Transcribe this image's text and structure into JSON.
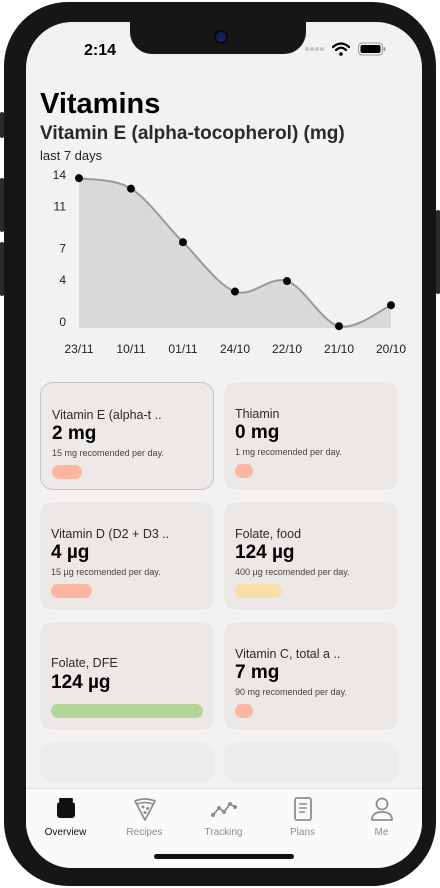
{
  "status": {
    "time": "2:14"
  },
  "header": {
    "title": "Vitamins",
    "subtitle": "Vitamin E (alpha-tocopherol) (mg)",
    "period": "last 7 days"
  },
  "chart_data": {
    "type": "area",
    "x": [
      "23/11",
      "10/11",
      "01/11",
      "24/10",
      "22/10",
      "21/10",
      "20/10"
    ],
    "values": [
      13.7,
      12.7,
      7.6,
      2.9,
      3.9,
      -0.4,
      1.6
    ],
    "yticks": [
      0,
      4,
      7,
      11,
      14
    ],
    "ylim": [
      0,
      14
    ],
    "grid": false,
    "colors": {
      "fill": "#d9d9d9",
      "line": "#9a9a9a",
      "point": "#000000"
    }
  },
  "cards": [
    {
      "name": "Vitamin E (alpha-t ..",
      "value": "2 mg",
      "recommended": "15 mg recomended per day.",
      "pill_color": "#ffb59f",
      "pill_fraction": 0.2,
      "selected": true
    },
    {
      "name": "Thiamin",
      "value": "0 mg",
      "recommended": "1 mg recomended per day.",
      "pill_color": "#ffb59f",
      "pill_fraction": 0.1,
      "selected": false
    },
    {
      "name": "Vitamin D (D2 + D3 ..",
      "value": "4 µg",
      "recommended": "15 µg recomended per day.",
      "pill_color": "#ffb59f",
      "pill_fraction": 0.27,
      "selected": false
    },
    {
      "name": "Folate, food",
      "value": "124 µg",
      "recommended": "400 µg recomended per day.",
      "pill_color": "#f8dfa6",
      "pill_fraction": 0.31,
      "selected": false
    },
    {
      "name": "Folate, DFE",
      "value": "124 µg",
      "recommended": "",
      "pill_color": "#b5d69a",
      "pill_fraction": 1.0,
      "selected": false
    },
    {
      "name": "Vitamin C, total a ..",
      "value": "7 mg",
      "recommended": "90 mg recomended per day.",
      "pill_color": "#ffb59f",
      "pill_fraction": 0.1,
      "selected": false
    }
  ],
  "tabs": [
    {
      "label": "Overview",
      "icon": "overview-icon",
      "active": true
    },
    {
      "label": "Recipes",
      "icon": "pizza-icon",
      "active": false
    },
    {
      "label": "Tracking",
      "icon": "tracking-icon",
      "active": false
    },
    {
      "label": "Plans",
      "icon": "document-icon",
      "active": false
    },
    {
      "label": "Me",
      "icon": "person-icon",
      "active": false
    }
  ]
}
